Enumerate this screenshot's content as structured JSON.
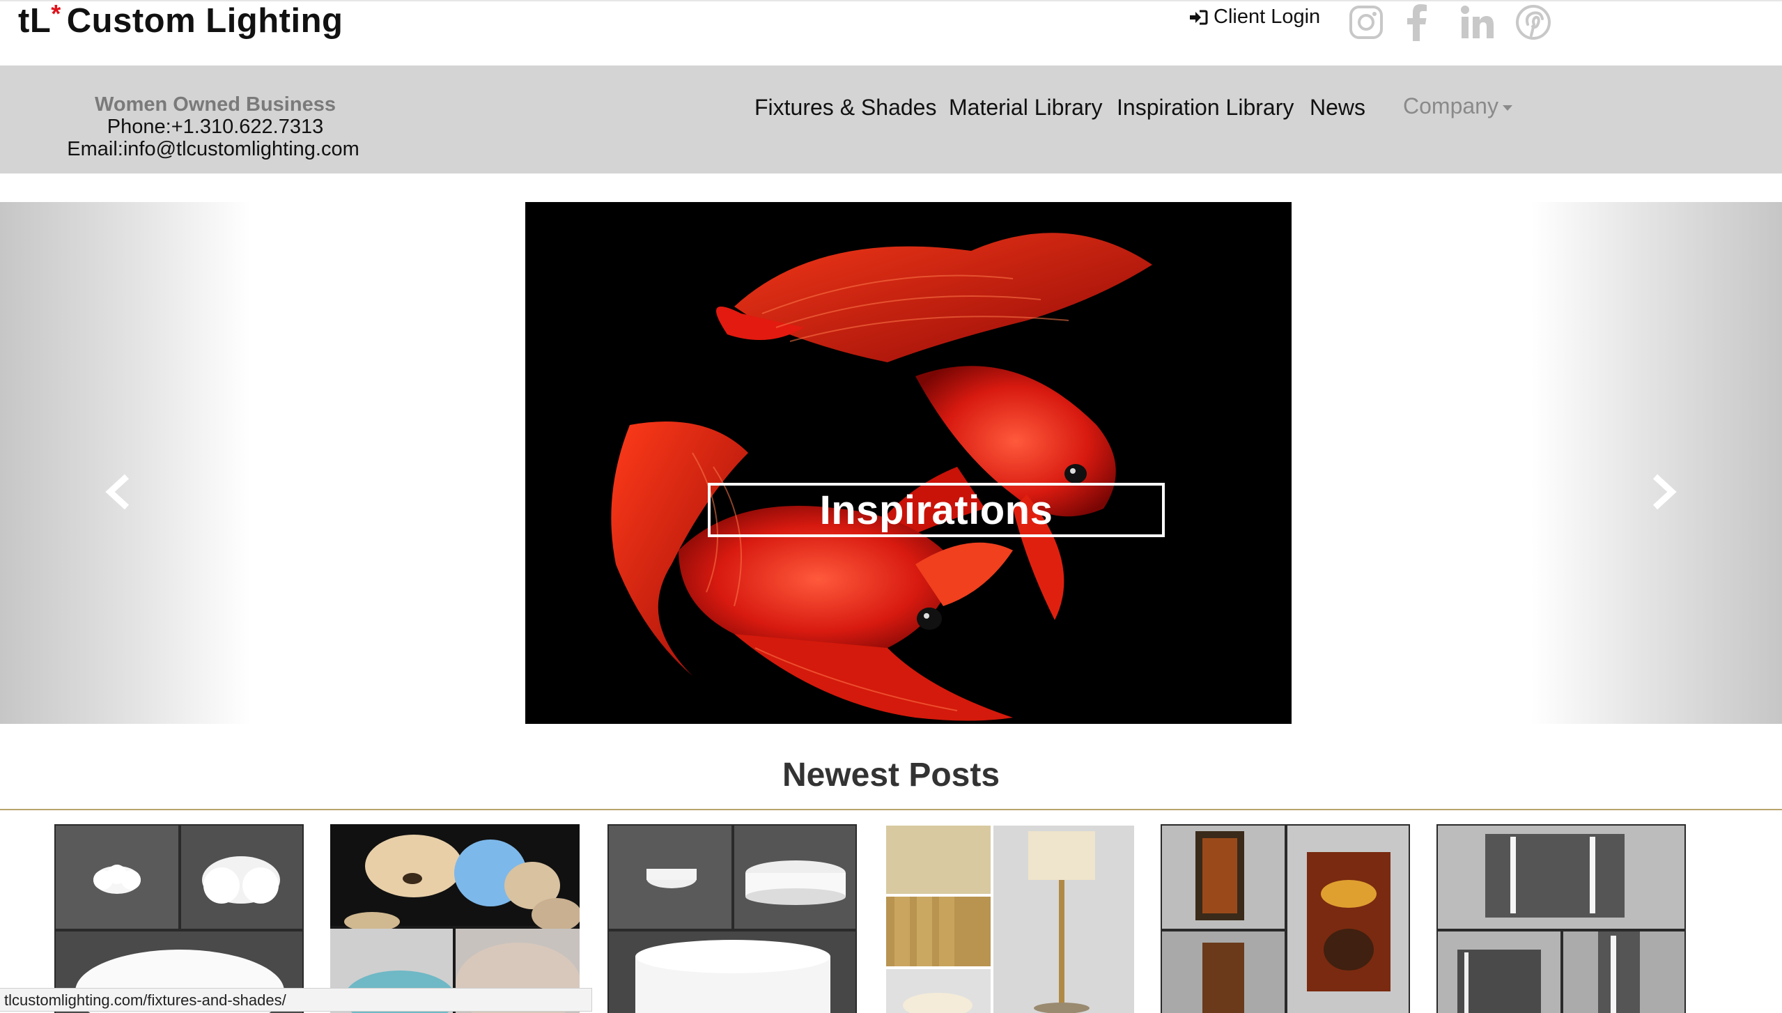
{
  "header": {
    "logo_prefix": "tL",
    "logo_asterisk": "*",
    "logo_name": "Custom Lighting",
    "client_login": "Client Login",
    "social_icons": [
      "instagram-icon",
      "facebook-icon",
      "linkedin-icon",
      "pinterest-icon"
    ]
  },
  "nav": {
    "contact": {
      "tagline": "Women Owned Business",
      "phone": "Phone:+1.310.622.7313",
      "email": "Email:info@tlcustomlighting.com"
    },
    "items": [
      {
        "label": "Fixtures & Shades"
      },
      {
        "label": "Material Library"
      },
      {
        "label": "Inspiration Library"
      },
      {
        "label": "News"
      }
    ],
    "company": "Company"
  },
  "carousel": {
    "caption": "Inspirations",
    "prev_icon": "chevron-left-icon",
    "next_icon": "chevron-right-icon"
  },
  "posts": {
    "title": "Newest Posts"
  },
  "status_bar": {
    "url": "tlcustomlighting.com/fixtures-and-shades/"
  },
  "colors": {
    "accent_red": "#e0121b",
    "nav_background": "#d4d4d4",
    "rule_gold": "#b8a36a"
  }
}
